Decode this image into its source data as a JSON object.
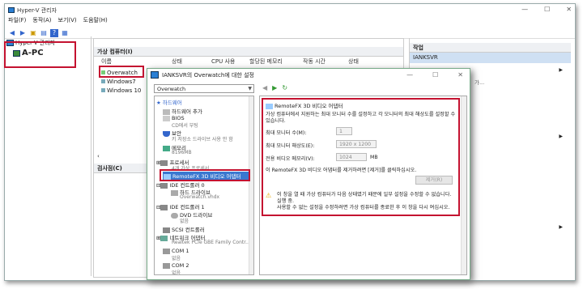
{
  "main": {
    "title": "Hyper-V 관리자",
    "menu": [
      "파일(F)",
      "동작(A)",
      "보기(V)",
      "도움말(H)"
    ],
    "tree_root": "Hyper-V 관리자",
    "tree_server": "A-PC"
  },
  "center": {
    "vm_section": "가상 컴퓨터(I)",
    "columns": [
      "이름",
      "상태",
      "CPU 사용",
      "할당된 메모리",
      "작동 시간",
      "상태"
    ],
    "vms": [
      "Overwatch",
      "Windows7",
      "Windows 10"
    ],
    "checkpoint_section": "검사점(C)"
  },
  "right": {
    "section": "작업",
    "server": "IANKSVR",
    "arrow1": "▶",
    "arrow2": "▶",
    "arrow3": "▶",
    "frag": "가..."
  },
  "dialog": {
    "title": "IANKSVR의 Overwatch에 대한 설정",
    "vm_select": "Overwatch",
    "hardware_header": "하드웨어",
    "hw": {
      "add_hw": "하드웨어 추가",
      "bios": "BIOS",
      "bios_sub": "CD에서 부팅",
      "security": "보안",
      "security_sub": "키 저장소 드라이브 사용 안 함",
      "memory": "메모리",
      "memory_sub": "8196MB",
      "cpu": "프로세서",
      "cpu_sub": "4개 가상 프로세서",
      "remotefx": "RemoteFX 3D 비디오 어댑터",
      "ide0": "IDE 컨트롤러 0",
      "hdd": "하드 드라이브",
      "hdd_sub": "Overwatch.vhdx",
      "ide1": "IDE 컨트롤러 1",
      "dvd": "DVD 드라이브",
      "dvd_sub": "없음",
      "scsi": "SCSI 컨트롤러",
      "nic": "네트워크 어댑터",
      "nic_sub": "Realtek PCIe GBE Family Contr...",
      "com1": "COM 1",
      "com1_sub": "없음",
      "com2": "COM 2",
      "com2_sub": "없음"
    },
    "panel": {
      "heading": "RemoteFX 3D 비디오 어댑터",
      "desc": "가상 컴퓨터에서 지원하는 최대 모니터 수를 설정하고 각 모니터의 최대 해상도를 설정할 수 있습니다.",
      "max_monitors_label": "최대 모니터 수(M):",
      "max_monitors_value": "1",
      "max_res_label": "최대 모니터 해상도(E):",
      "max_res_value": "1920 x 1200",
      "vram_label": "전용 비디오 메모리(V):",
      "vram_value": "1024",
      "vram_unit": "MB",
      "remove_text": "이 RemoteFX 3D 비디오 어댑터를 제거하려면 [제거]를 클릭하십시오.",
      "remove_button": "제거(R)",
      "warning": "이 창을 열 때 가상 컴퓨터가 다음 상태였기 때문에 일부 설정을 수정할 수 없습니다. 실행 중.\n사용할 수 없는 설정을 수정하려면 가상 컴퓨터를 종료한 후 이 창을 다시 여십시오."
    }
  }
}
